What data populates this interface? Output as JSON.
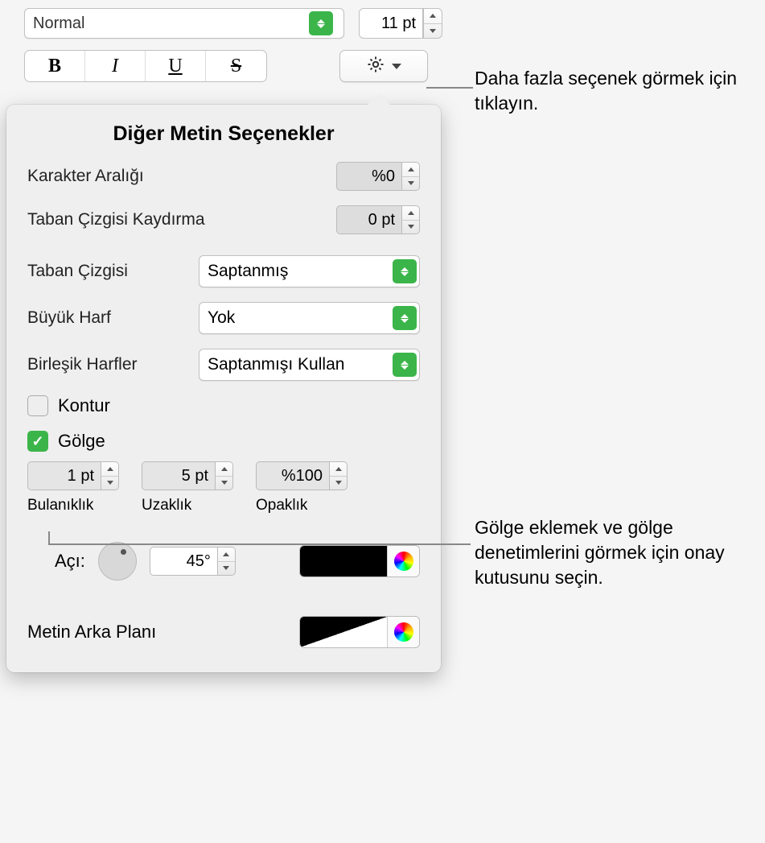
{
  "top": {
    "font_style": "Normal",
    "font_size": "11 pt",
    "bold": "B",
    "italic": "I",
    "underline": "U",
    "strike": "S"
  },
  "popover": {
    "title": "Diğer Metin Seçenekler",
    "char_spacing_label": "Karakter Aralığı",
    "char_spacing_value": "%0",
    "baseline_shift_label": "Taban Çizgisi Kaydırma",
    "baseline_shift_value": "0 pt",
    "baseline_label": "Taban Çizgisi",
    "baseline_value": "Saptanmış",
    "caps_label": "Büyük Harf",
    "caps_value": "Yok",
    "ligatures_label": "Birleşik Harfler",
    "ligatures_value": "Saptanmışı Kullan",
    "outline_label": "Kontur",
    "shadow_label": "Gölge",
    "blur_value": "1 pt",
    "blur_label": "Bulanıklık",
    "dist_value": "5 pt",
    "dist_label": "Uzaklık",
    "opacity_value": "%100",
    "opacity_label": "Opaklık",
    "angle_label": "Açı:",
    "angle_value": "45°",
    "bg_label": "Metin Arka Planı"
  },
  "callouts": {
    "more": "Daha fazla seçenek görmek için tıklayın.",
    "shadow": "Gölge eklemek ve gölge denetimlerini görmek için onay kutusunu seçin."
  }
}
